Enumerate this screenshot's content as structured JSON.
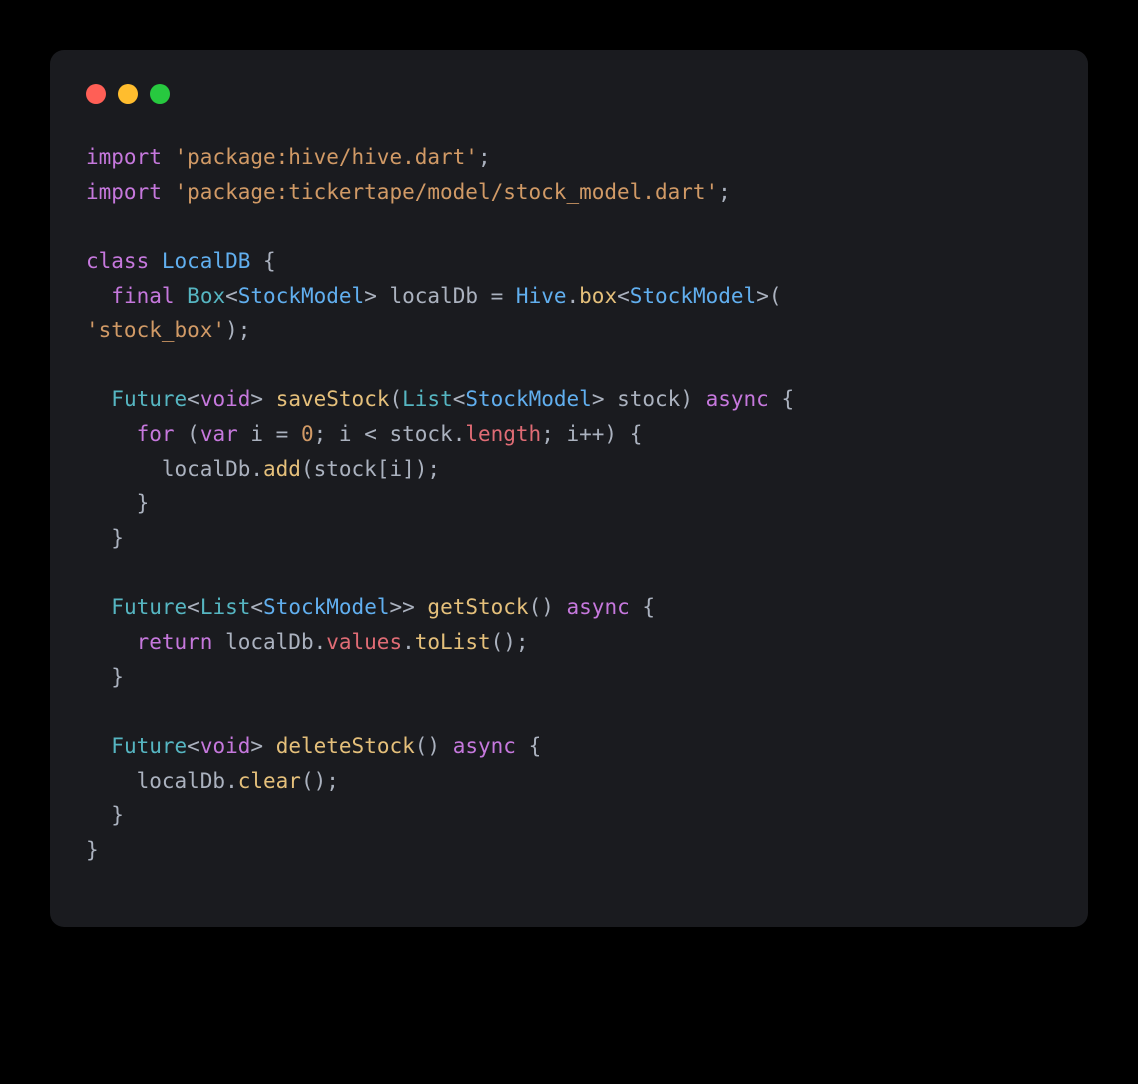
{
  "code": {
    "tokens": [
      {
        "c": "kw",
        "t": "import"
      },
      {
        "t": " "
      },
      {
        "c": "str",
        "t": "'package:hive/hive.dart'"
      },
      {
        "t": ";"
      },
      {
        "nl": 1
      },
      {
        "c": "kw",
        "t": "import"
      },
      {
        "t": " "
      },
      {
        "c": "str",
        "t": "'package:tickertape/model/stock_model.dart'"
      },
      {
        "t": ";"
      },
      {
        "nl": 1
      },
      {
        "nl": 1
      },
      {
        "c": "kw",
        "t": "class"
      },
      {
        "t": " "
      },
      {
        "c": "cls",
        "t": "LocalDB"
      },
      {
        "t": " {"
      },
      {
        "nl": 1
      },
      {
        "t": "  "
      },
      {
        "c": "kw",
        "t": "final"
      },
      {
        "t": " "
      },
      {
        "c": "type",
        "t": "Box"
      },
      {
        "t": "<"
      },
      {
        "c": "cls",
        "t": "StockModel"
      },
      {
        "t": "> localDb = "
      },
      {
        "c": "cls",
        "t": "Hive"
      },
      {
        "t": "."
      },
      {
        "c": "fn",
        "t": "box"
      },
      {
        "t": "<"
      },
      {
        "c": "cls",
        "t": "StockModel"
      },
      {
        "t": ">("
      },
      {
        "nl": 1
      },
      {
        "c": "str",
        "t": "'stock_box'"
      },
      {
        "t": ");"
      },
      {
        "nl": 1
      },
      {
        "nl": 1
      },
      {
        "t": "  "
      },
      {
        "c": "type",
        "t": "Future"
      },
      {
        "t": "<"
      },
      {
        "c": "kw",
        "t": "void"
      },
      {
        "t": "> "
      },
      {
        "c": "fn",
        "t": "saveStock"
      },
      {
        "t": "("
      },
      {
        "c": "type",
        "t": "List"
      },
      {
        "t": "<"
      },
      {
        "c": "cls",
        "t": "StockModel"
      },
      {
        "t": "> stock) "
      },
      {
        "c": "kw",
        "t": "async"
      },
      {
        "t": " {"
      },
      {
        "nl": 1
      },
      {
        "t": "    "
      },
      {
        "c": "kw",
        "t": "for"
      },
      {
        "t": " ("
      },
      {
        "c": "kw",
        "t": "var"
      },
      {
        "t": " i = "
      },
      {
        "c": "num",
        "t": "0"
      },
      {
        "t": "; i < stock."
      },
      {
        "c": "id",
        "t": "length"
      },
      {
        "t": "; i++) {"
      },
      {
        "nl": 1
      },
      {
        "t": "      localDb."
      },
      {
        "c": "fn",
        "t": "add"
      },
      {
        "t": "(stock[i]);"
      },
      {
        "nl": 1
      },
      {
        "t": "    }"
      },
      {
        "nl": 1
      },
      {
        "t": "  }"
      },
      {
        "nl": 1
      },
      {
        "nl": 1
      },
      {
        "t": "  "
      },
      {
        "c": "type",
        "t": "Future"
      },
      {
        "t": "<"
      },
      {
        "c": "type",
        "t": "List"
      },
      {
        "t": "<"
      },
      {
        "c": "cls",
        "t": "StockModel"
      },
      {
        "t": ">> "
      },
      {
        "c": "fn",
        "t": "getStock"
      },
      {
        "t": "() "
      },
      {
        "c": "kw",
        "t": "async"
      },
      {
        "t": " {"
      },
      {
        "nl": 1
      },
      {
        "t": "    "
      },
      {
        "c": "kw",
        "t": "return"
      },
      {
        "t": " localDb."
      },
      {
        "c": "id",
        "t": "values"
      },
      {
        "t": "."
      },
      {
        "c": "fn",
        "t": "toList"
      },
      {
        "t": "();"
      },
      {
        "nl": 1
      },
      {
        "t": "  }"
      },
      {
        "nl": 1
      },
      {
        "nl": 1
      },
      {
        "t": "  "
      },
      {
        "c": "type",
        "t": "Future"
      },
      {
        "t": "<"
      },
      {
        "c": "kw",
        "t": "void"
      },
      {
        "t": "> "
      },
      {
        "c": "fn",
        "t": "deleteStock"
      },
      {
        "t": "() "
      },
      {
        "c": "kw",
        "t": "async"
      },
      {
        "t": " {"
      },
      {
        "nl": 1
      },
      {
        "t": "    localDb."
      },
      {
        "c": "fn",
        "t": "clear"
      },
      {
        "t": "();"
      },
      {
        "nl": 1
      },
      {
        "t": "  }"
      },
      {
        "nl": 1
      },
      {
        "t": "}"
      }
    ]
  }
}
